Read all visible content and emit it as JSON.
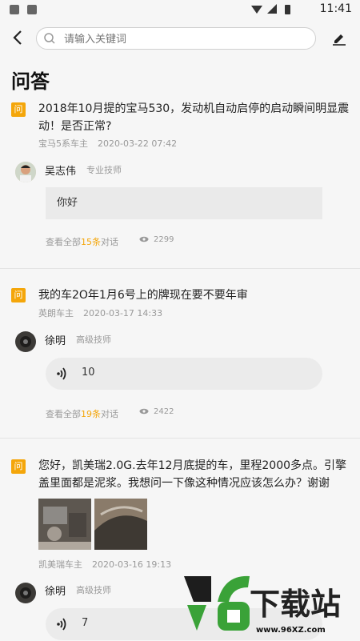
{
  "status": {
    "time": "11:41"
  },
  "search": {
    "placeholder": "请输入关键词"
  },
  "page_title": "问答",
  "qa": [
    {
      "badge": "问",
      "question": "2018年10月提的宝马530，发动机自动启停的启动瞬间明显震动！是否正常?",
      "owner": "宝马5系车主",
      "date": "2020-03-22 07:42",
      "answerer": "吴志伟",
      "role": "专业技师",
      "answer": "你好",
      "footer_prefix": "查看全部",
      "footer_count": "15条",
      "footer_suffix": "对话",
      "views": "2299"
    },
    {
      "badge": "问",
      "question": "我的车2O年1月6号上的牌现在要不要年审",
      "owner": "英朗车主",
      "date": "2020-03-17 14:33",
      "answerer": "徐明",
      "role": "高级技师",
      "voice_seconds": "10",
      "footer_prefix": "查看全部",
      "footer_count": "19条",
      "footer_suffix": "对话",
      "views": "2422"
    },
    {
      "badge": "问",
      "question": "您好，凯美瑞2.0G.去年12月底提的车，里程2000多点。引擎盖里面都是泥浆。我想问一下像这种情况应该怎么办？谢谢",
      "owner": "凯美瑞车主",
      "date": "2020-03-16 19:13",
      "answerer": "徐明",
      "role": "高级技师",
      "voice_seconds": "7"
    }
  ],
  "watermark": {
    "brand": "96下载站",
    "url": "www.96XZ.com"
  },
  "colors": {
    "accent": "#f4a60a",
    "background": "#f6f6f6"
  }
}
